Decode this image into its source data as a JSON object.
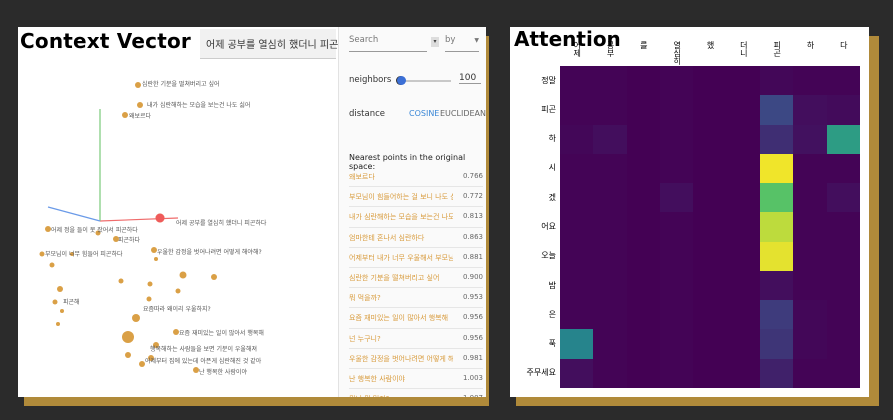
{
  "left_panel": {
    "title": "Context Vector",
    "selected_point": "어제 공부를 열심히 했더니 피곤하다",
    "point_labels": [
      {
        "text": "심란한 기분을 떨쳐버리고 싶어"
      },
      {
        "text": "내가 심란해하는 모습을 보는건 나도 싫어"
      },
      {
        "text": "왜보르다"
      },
      {
        "text": "어제 정을 들이 못 잤어서 피곤하다"
      },
      {
        "text": "피곤하다"
      },
      {
        "text": "우울한 감정을 벗어나려면 어떻게 해야해?"
      },
      {
        "text": "어제 공부를 열심히 했더니 피곤하다"
      },
      {
        "text": "부모님이 너무 힘들어 피곤하다"
      },
      {
        "text": "피곤해"
      },
      {
        "text": "요즘따라 왜이리 우울하지?"
      },
      {
        "text": "요즘 재미있는 일이 많아서 행복해"
      },
      {
        "text": "행복해하는 사람들을 보면 기분이 우울해져"
      },
      {
        "text": "어제부터 집에 있는데 아픈게 심란해진 것 같아"
      },
      {
        "text": "난 행복한 사람이야"
      }
    ],
    "search": {
      "placeholder": "Search",
      "by": "by"
    },
    "neighbors": {
      "label": "neighbors",
      "help": "?",
      "value": "100"
    },
    "distance": {
      "label": "distance",
      "cosine": "COSINE",
      "euclidean": "EUCLIDEAN"
    },
    "nearest_title": "Nearest points in the original space:",
    "nearest": [
      {
        "text": "왜보르다",
        "score": "0.766"
      },
      {
        "text": "부모님이 힘들어하는 걸 보니 나도 심...",
        "score": "0.772"
      },
      {
        "text": "내가 심란해하는 모습을 보는건 나도 싫어",
        "score": "0.813"
      },
      {
        "text": "엄마한테 혼나서 심란하다",
        "score": "0.863"
      },
      {
        "text": "어제부터 내가 너무 우울해서 부모님이...",
        "score": "0.881"
      },
      {
        "text": "심란한 기분을 떨쳐버리고 싶어",
        "score": "0.900"
      },
      {
        "text": "뭐 먹을까?",
        "score": "0.953"
      },
      {
        "text": "요즘 재미있는 일이 많아서 행복해",
        "score": "0.956"
      },
      {
        "text": "넌 누구니?",
        "score": "0.956"
      },
      {
        "text": "우울한 감정을 벗어나려면 어떻게 해야해?",
        "score": "0.981"
      },
      {
        "text": "난 행복한 사람이야",
        "score": "1.003"
      },
      {
        "text": "뭐니 뭐 먹지?",
        "score": "1.007"
      }
    ]
  },
  "right_panel": {
    "title": "Attention",
    "rows": [
      "정말",
      "피곤",
      "하",
      "시",
      "겠",
      "어요",
      "오늘",
      "밤",
      "은",
      "푹",
      "주무세요"
    ],
    "columns": [
      "어제",
      "공부",
      "를",
      "열심히",
      "했",
      "더니",
      "피곤",
      "하",
      "다"
    ],
    "colors": {
      "background": "#440154",
      "accent": "#d89b3c"
    }
  },
  "chart_data": {
    "type": "heatmap",
    "title": "Attention",
    "x": [
      "어제",
      "공부",
      "를",
      "열심히",
      "했",
      "더니",
      "피곤",
      "하",
      "다"
    ],
    "y": [
      "정말",
      "피곤",
      "하",
      "시",
      "겠",
      "어요",
      "오늘",
      "밤",
      "은",
      "푹",
      "주무세요"
    ],
    "values": [
      [
        0.01,
        0.01,
        0.0,
        0.01,
        0.0,
        0.0,
        0.02,
        0.01,
        0.01
      ],
      [
        0.01,
        0.01,
        0.0,
        0.01,
        0.0,
        0.0,
        0.22,
        0.04,
        0.03
      ],
      [
        0.02,
        0.04,
        0.0,
        0.01,
        0.0,
        0.0,
        0.14,
        0.05,
        0.55
      ],
      [
        0.01,
        0.01,
        0.0,
        0.01,
        0.0,
        0.0,
        0.98,
        0.01,
        0.01
      ],
      [
        0.01,
        0.01,
        0.0,
        0.04,
        0.0,
        0.0,
        0.72,
        0.01,
        0.04
      ],
      [
        0.01,
        0.01,
        0.0,
        0.01,
        0.0,
        0.0,
        0.9,
        0.01,
        0.01
      ],
      [
        0.01,
        0.01,
        0.0,
        0.01,
        0.0,
        0.0,
        0.96,
        0.01,
        0.01
      ],
      [
        0.01,
        0.01,
        0.0,
        0.01,
        0.0,
        0.0,
        0.04,
        0.01,
        0.01
      ],
      [
        0.01,
        0.01,
        0.0,
        0.01,
        0.0,
        0.0,
        0.18,
        0.02,
        0.01
      ],
      [
        0.45,
        0.01,
        0.0,
        0.01,
        0.0,
        0.0,
        0.16,
        0.02,
        0.01
      ],
      [
        0.04,
        0.01,
        0.0,
        0.01,
        0.0,
        0.0,
        0.1,
        0.01,
        0.01
      ]
    ]
  }
}
